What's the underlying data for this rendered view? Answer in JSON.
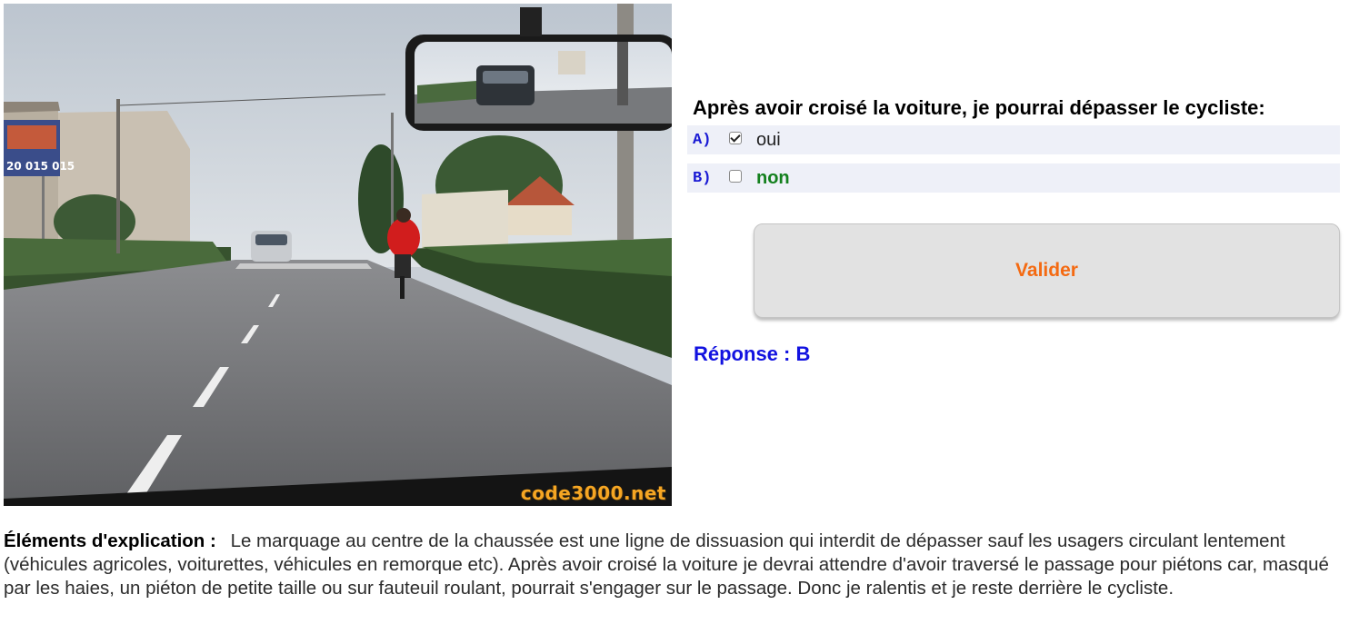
{
  "scene": {
    "watermark": "code3000.net",
    "billboard_text": "20 015 015"
  },
  "question": {
    "text": "Après avoir croisé la voiture, je pourrai dépasser le cycliste:"
  },
  "answers": [
    {
      "letter": "A)",
      "label": "oui",
      "checked": true,
      "correct": false
    },
    {
      "letter": "B)",
      "label": "non",
      "checked": false,
      "correct": true
    }
  ],
  "validate_label": "Valider",
  "response": "Réponse : B",
  "explanation": {
    "heading": "Éléments d'explication :",
    "body": "Le marquage au centre de la chaussée est une ligne de dissuasion qui interdit de dépasser sauf les usagers circulant lentement (véhicules agricoles, voiturettes, véhicules en remorque etc). Après avoir croisé la voiture je devrai attendre d'avoir traversé le passage pour piétons car, masqué par les haies, un piéton de petite taille ou sur fauteuil roulant, pourrait s'engager sur le passage. Donc je ralentis et je reste derrière le cycliste."
  },
  "colors": {
    "answer_letter": "#1a1ad4",
    "correct_answer": "#14801e",
    "validate_text": "#f46a12",
    "response_text": "#1212e0",
    "watermark": "#f6a623"
  }
}
